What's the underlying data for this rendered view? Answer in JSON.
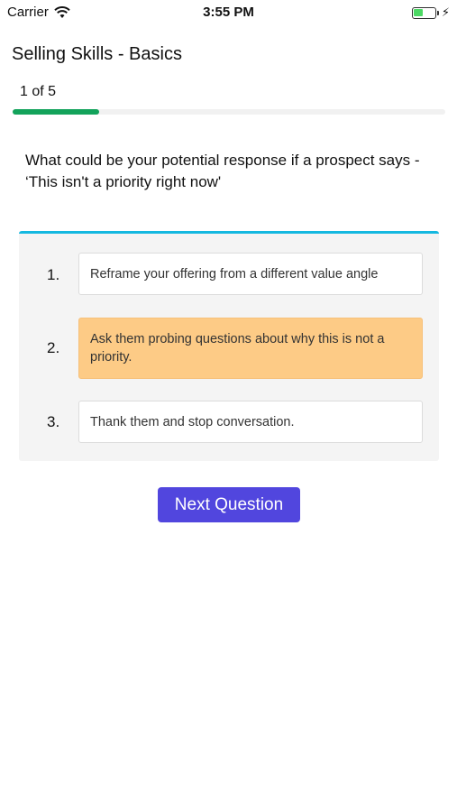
{
  "status_bar": {
    "carrier": "Carrier",
    "time": "3:55 PM"
  },
  "header": {
    "title": "Selling Skills - Basics"
  },
  "progress": {
    "label": "1 of 5",
    "current": 1,
    "total": 5,
    "fraction": 0.2,
    "color": "#13a35b"
  },
  "question": {
    "text": "What could be your potential response if a prospect says - ‘This isn't a priority right now'"
  },
  "options": [
    {
      "number": "1.",
      "text": "Reframe your offering from a different value angle",
      "selected": false
    },
    {
      "number": "2.",
      "text": "Ask them probing questions about why this is not a priority.",
      "selected": true
    },
    {
      "number": "3.",
      "text": "Thank them and stop conversation.",
      "selected": false
    }
  ],
  "actions": {
    "next_label": "Next Question"
  },
  "colors": {
    "accent_button": "#5146de",
    "panel_border": "#14b8e0",
    "selected_option": "#fdcb86"
  }
}
